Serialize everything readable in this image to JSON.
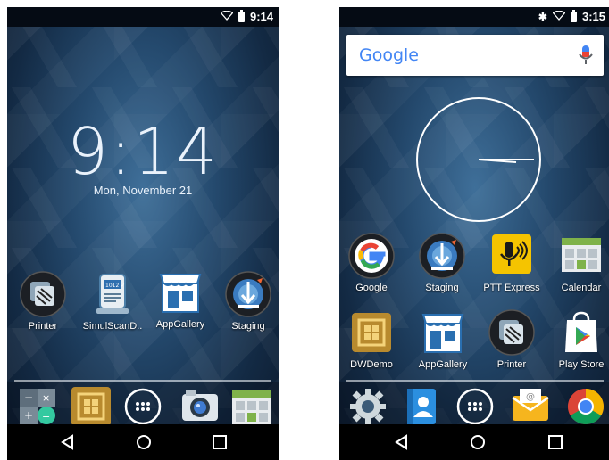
{
  "lock_phone": {
    "status": {
      "time": "9:14"
    },
    "clock": {
      "time": "9:14",
      "date": "Mon, November 21"
    },
    "apps": [
      {
        "label": "Printer",
        "icon": "printer-icon"
      },
      {
        "label": "SimulScanD..",
        "icon": "simulscan-icon"
      },
      {
        "label": "AppGallery",
        "icon": "appgallery-icon"
      },
      {
        "label": "Staging",
        "icon": "staging-icon"
      }
    ],
    "dock": [
      {
        "icon": "calculator-icon"
      },
      {
        "icon": "dwdemo-icon"
      },
      {
        "icon": "app-drawer-icon"
      },
      {
        "icon": "camera-icon"
      },
      {
        "icon": "calendar-icon"
      }
    ],
    "nav": [
      "back-icon",
      "home-icon",
      "recents-icon"
    ]
  },
  "home_phone": {
    "status": {
      "time": "3:15"
    },
    "search": {
      "logo": "Google"
    },
    "apps_row1": [
      {
        "label": "Google",
        "icon": "google-app-icon"
      },
      {
        "label": "Staging",
        "icon": "staging-icon"
      },
      {
        "label": "PTT Express",
        "icon": "ptt-express-icon"
      },
      {
        "label": "Calendar",
        "icon": "calendar-icon"
      }
    ],
    "apps_row2": [
      {
        "label": "DWDemo",
        "icon": "dwdemo-icon"
      },
      {
        "label": "AppGallery",
        "icon": "appgallery-icon"
      },
      {
        "label": "Printer",
        "icon": "printer-icon"
      },
      {
        "label": "Play Store",
        "icon": "play-store-icon"
      }
    ],
    "dock": [
      {
        "icon": "settings-icon"
      },
      {
        "icon": "contacts-icon"
      },
      {
        "icon": "app-drawer-icon"
      },
      {
        "icon": "email-icon"
      },
      {
        "icon": "chrome-icon"
      }
    ],
    "nav": [
      "back-icon",
      "home-icon",
      "recents-icon"
    ]
  },
  "colors": {
    "wallpaper": "#24496d",
    "dwdemo_gold": "#b88a2e",
    "ptt_yellow": "#f5c400",
    "google_blue": "#4285f4",
    "google_red": "#ea4335",
    "google_yellow": "#fbbc05",
    "google_green": "#34a853"
  }
}
